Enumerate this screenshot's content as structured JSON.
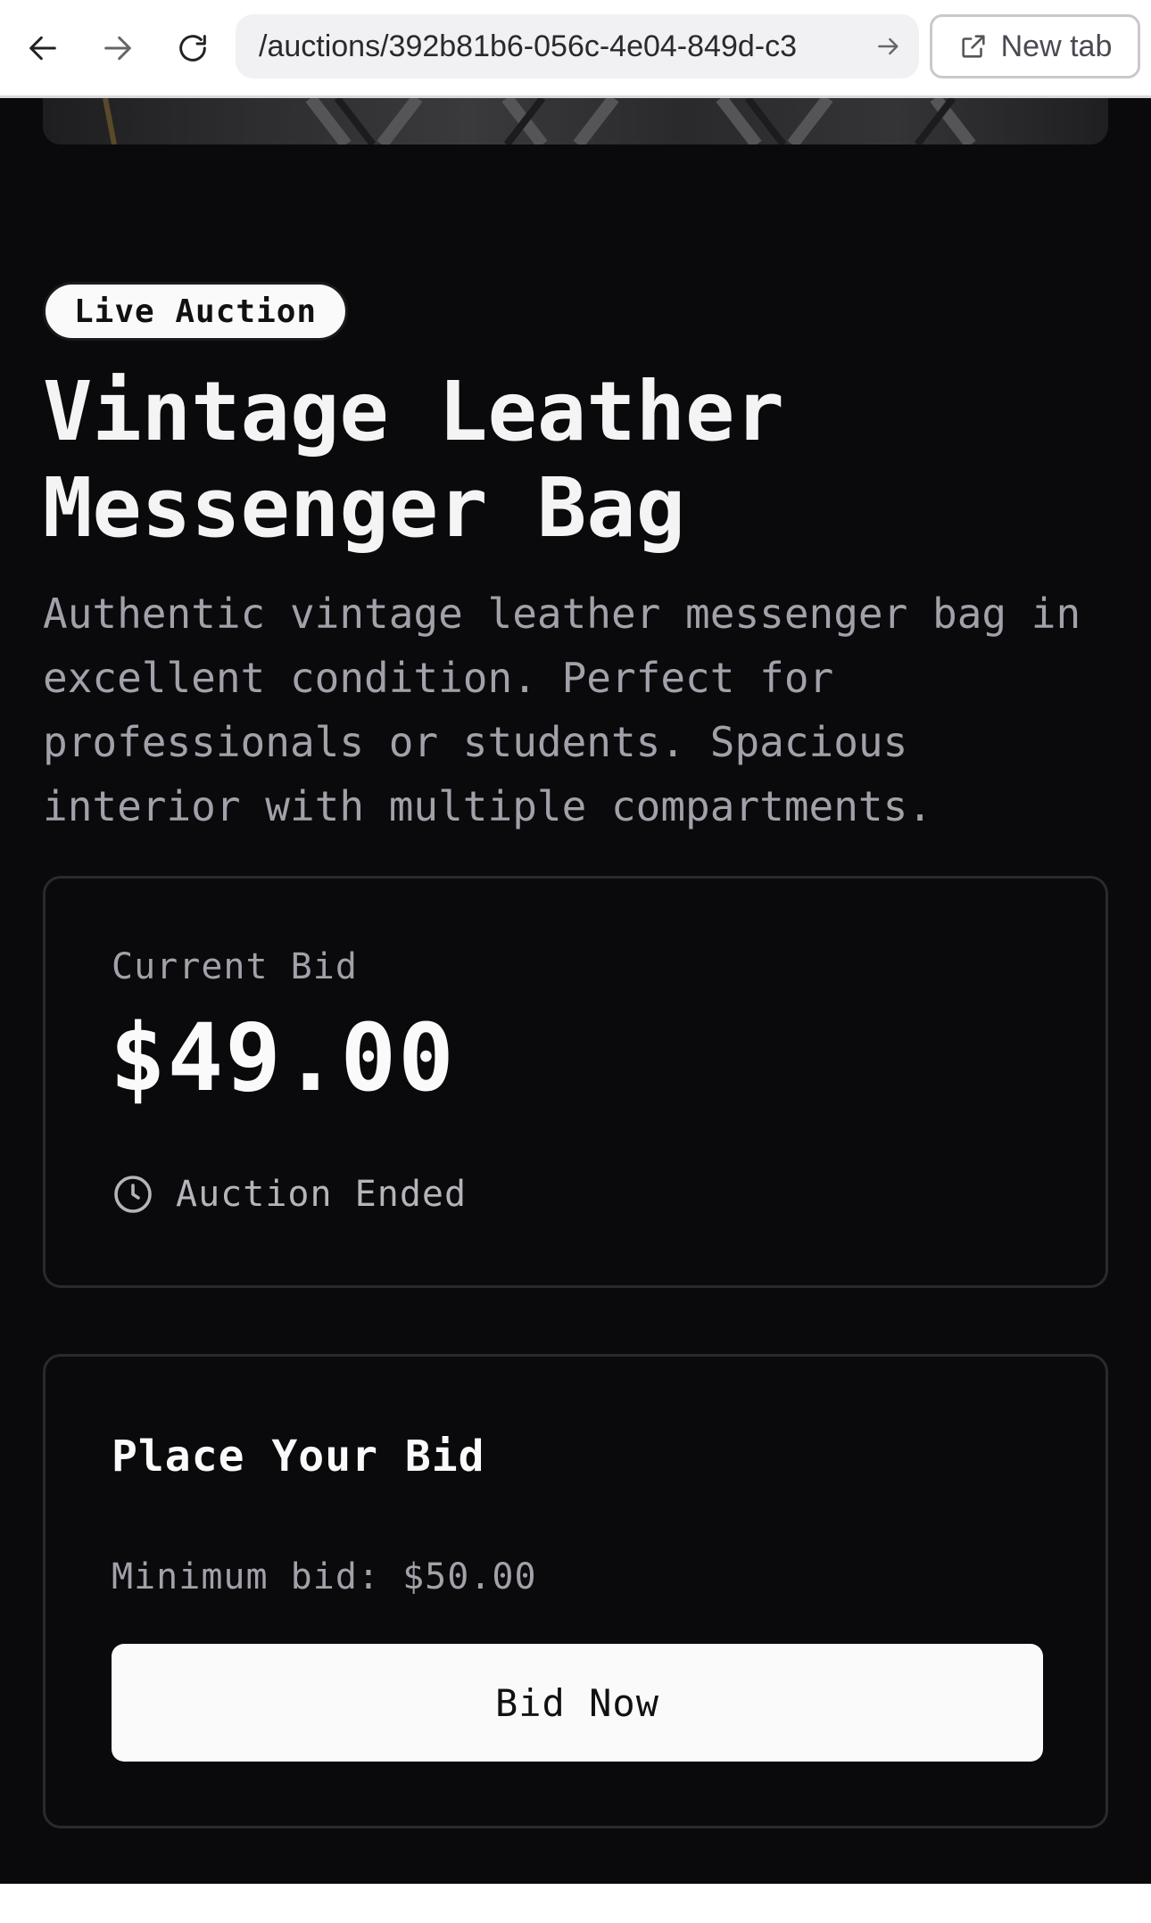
{
  "browser": {
    "url": "/auctions/392b81b6-056c-4e04-849d-c3",
    "new_tab_label": "New tab"
  },
  "auction": {
    "badge": "Live Auction",
    "title": "Vintage Leather Messenger Bag",
    "description": "Authentic vintage leather messenger bag in excellent condition. Perfect for professionals or students. Spacious interior with multiple compartments."
  },
  "bid_card": {
    "label": "Current Bid",
    "amount": "$49.00",
    "status": "Auction Ended",
    "status_icon": "clock-icon"
  },
  "place_bid": {
    "heading": "Place Your Bid",
    "minimum": "Minimum bid: $50.00",
    "button_label": "Bid Now"
  },
  "colors": {
    "background": "#0a0a0c",
    "text_primary": "#fafafa",
    "text_muted": "#a1a1aa",
    "border": "#2a2a2e"
  }
}
